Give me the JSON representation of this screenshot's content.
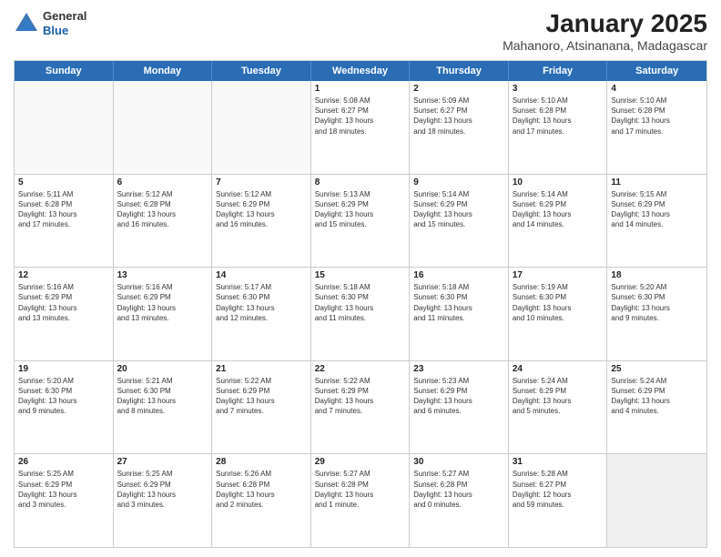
{
  "logo": {
    "general": "General",
    "blue": "Blue"
  },
  "title": "January 2025",
  "subtitle": "Mahanoro, Atsinanana, Madagascar",
  "days": [
    "Sunday",
    "Monday",
    "Tuesday",
    "Wednesday",
    "Thursday",
    "Friday",
    "Saturday"
  ],
  "rows": [
    [
      {
        "day": "",
        "empty": true
      },
      {
        "day": "",
        "empty": true
      },
      {
        "day": "",
        "empty": true
      },
      {
        "day": "1",
        "lines": [
          "Sunrise: 5:08 AM",
          "Sunset: 6:27 PM",
          "Daylight: 13 hours",
          "and 18 minutes."
        ]
      },
      {
        "day": "2",
        "lines": [
          "Sunrise: 5:09 AM",
          "Sunset: 6:27 PM",
          "Daylight: 13 hours",
          "and 18 minutes."
        ]
      },
      {
        "day": "3",
        "lines": [
          "Sunrise: 5:10 AM",
          "Sunset: 6:28 PM",
          "Daylight: 13 hours",
          "and 17 minutes."
        ]
      },
      {
        "day": "4",
        "lines": [
          "Sunrise: 5:10 AM",
          "Sunset: 6:28 PM",
          "Daylight: 13 hours",
          "and 17 minutes."
        ]
      }
    ],
    [
      {
        "day": "5",
        "lines": [
          "Sunrise: 5:11 AM",
          "Sunset: 6:28 PM",
          "Daylight: 13 hours",
          "and 17 minutes."
        ]
      },
      {
        "day": "6",
        "lines": [
          "Sunrise: 5:12 AM",
          "Sunset: 6:28 PM",
          "Daylight: 13 hours",
          "and 16 minutes."
        ]
      },
      {
        "day": "7",
        "lines": [
          "Sunrise: 5:12 AM",
          "Sunset: 6:29 PM",
          "Daylight: 13 hours",
          "and 16 minutes."
        ]
      },
      {
        "day": "8",
        "lines": [
          "Sunrise: 5:13 AM",
          "Sunset: 6:29 PM",
          "Daylight: 13 hours",
          "and 15 minutes."
        ]
      },
      {
        "day": "9",
        "lines": [
          "Sunrise: 5:14 AM",
          "Sunset: 6:29 PM",
          "Daylight: 13 hours",
          "and 15 minutes."
        ]
      },
      {
        "day": "10",
        "lines": [
          "Sunrise: 5:14 AM",
          "Sunset: 6:29 PM",
          "Daylight: 13 hours",
          "and 14 minutes."
        ]
      },
      {
        "day": "11",
        "lines": [
          "Sunrise: 5:15 AM",
          "Sunset: 6:29 PM",
          "Daylight: 13 hours",
          "and 14 minutes."
        ]
      }
    ],
    [
      {
        "day": "12",
        "lines": [
          "Sunrise: 5:16 AM",
          "Sunset: 6:29 PM",
          "Daylight: 13 hours",
          "and 13 minutes."
        ]
      },
      {
        "day": "13",
        "lines": [
          "Sunrise: 5:16 AM",
          "Sunset: 6:29 PM",
          "Daylight: 13 hours",
          "and 13 minutes."
        ]
      },
      {
        "day": "14",
        "lines": [
          "Sunrise: 5:17 AM",
          "Sunset: 6:30 PM",
          "Daylight: 13 hours",
          "and 12 minutes."
        ]
      },
      {
        "day": "15",
        "lines": [
          "Sunrise: 5:18 AM",
          "Sunset: 6:30 PM",
          "Daylight: 13 hours",
          "and 11 minutes."
        ]
      },
      {
        "day": "16",
        "lines": [
          "Sunrise: 5:18 AM",
          "Sunset: 6:30 PM",
          "Daylight: 13 hours",
          "and 11 minutes."
        ]
      },
      {
        "day": "17",
        "lines": [
          "Sunrise: 5:19 AM",
          "Sunset: 6:30 PM",
          "Daylight: 13 hours",
          "and 10 minutes."
        ]
      },
      {
        "day": "18",
        "lines": [
          "Sunrise: 5:20 AM",
          "Sunset: 6:30 PM",
          "Daylight: 13 hours",
          "and 9 minutes."
        ]
      }
    ],
    [
      {
        "day": "19",
        "lines": [
          "Sunrise: 5:20 AM",
          "Sunset: 6:30 PM",
          "Daylight: 13 hours",
          "and 9 minutes."
        ]
      },
      {
        "day": "20",
        "lines": [
          "Sunrise: 5:21 AM",
          "Sunset: 6:30 PM",
          "Daylight: 13 hours",
          "and 8 minutes."
        ]
      },
      {
        "day": "21",
        "lines": [
          "Sunrise: 5:22 AM",
          "Sunset: 6:29 PM",
          "Daylight: 13 hours",
          "and 7 minutes."
        ]
      },
      {
        "day": "22",
        "lines": [
          "Sunrise: 5:22 AM",
          "Sunset: 6:29 PM",
          "Daylight: 13 hours",
          "and 7 minutes."
        ]
      },
      {
        "day": "23",
        "lines": [
          "Sunrise: 5:23 AM",
          "Sunset: 6:29 PM",
          "Daylight: 13 hours",
          "and 6 minutes."
        ]
      },
      {
        "day": "24",
        "lines": [
          "Sunrise: 5:24 AM",
          "Sunset: 6:29 PM",
          "Daylight: 13 hours",
          "and 5 minutes."
        ]
      },
      {
        "day": "25",
        "lines": [
          "Sunrise: 5:24 AM",
          "Sunset: 6:29 PM",
          "Daylight: 13 hours",
          "and 4 minutes."
        ]
      }
    ],
    [
      {
        "day": "26",
        "lines": [
          "Sunrise: 5:25 AM",
          "Sunset: 6:29 PM",
          "Daylight: 13 hours",
          "and 3 minutes."
        ]
      },
      {
        "day": "27",
        "lines": [
          "Sunrise: 5:25 AM",
          "Sunset: 6:29 PM",
          "Daylight: 13 hours",
          "and 3 minutes."
        ]
      },
      {
        "day": "28",
        "lines": [
          "Sunrise: 5:26 AM",
          "Sunset: 6:28 PM",
          "Daylight: 13 hours",
          "and 2 minutes."
        ]
      },
      {
        "day": "29",
        "lines": [
          "Sunrise: 5:27 AM",
          "Sunset: 6:28 PM",
          "Daylight: 13 hours",
          "and 1 minute."
        ]
      },
      {
        "day": "30",
        "lines": [
          "Sunrise: 5:27 AM",
          "Sunset: 6:28 PM",
          "Daylight: 13 hours",
          "and 0 minutes."
        ]
      },
      {
        "day": "31",
        "lines": [
          "Sunrise: 5:28 AM",
          "Sunset: 6:27 PM",
          "Daylight: 12 hours",
          "and 59 minutes."
        ]
      },
      {
        "day": "",
        "empty": true,
        "shaded": true
      }
    ]
  ]
}
